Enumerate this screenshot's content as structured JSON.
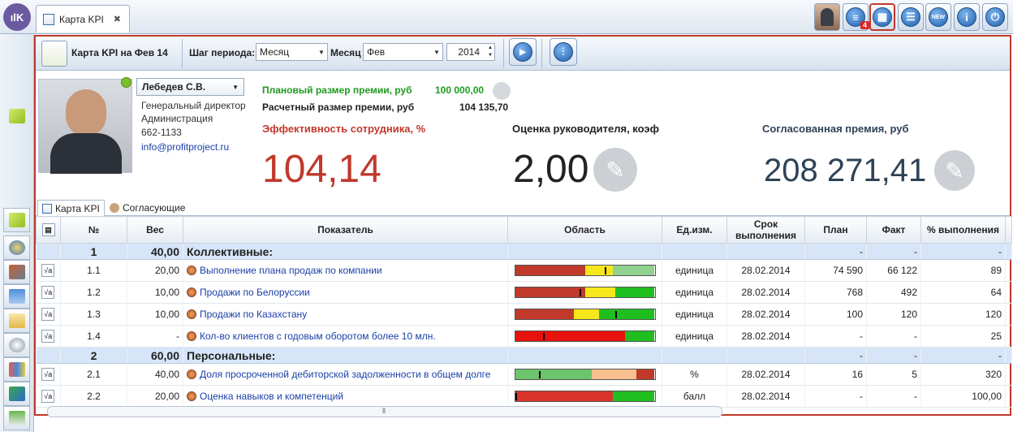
{
  "app": {
    "logo": "ılK",
    "tab_label": "Карта KPI",
    "tab_close": "✖",
    "badge": "4",
    "colors": {
      "accent": "#c0392b",
      "link": "#1a3fa8",
      "group_bg": "#d6e5f7"
    }
  },
  "top_icons": [
    "avatar-icon",
    "messages-icon",
    "grid-icon",
    "list-icon",
    "new-icon",
    "info-icon",
    "power-icon"
  ],
  "toolbar": {
    "title": "Карта KPI на Фев 14",
    "period_label": "Шаг периода:",
    "period_value": "Месяц",
    "month_label": "Месяц",
    "month_value": "Фев",
    "year_value": "2014"
  },
  "employee": {
    "name": "Лебедев С.В.",
    "position": "Генеральный директор",
    "department": "Администрация",
    "phone": "662-1133",
    "email": "info@profitproject.ru"
  },
  "bonus": {
    "planned_label": "Плановый размер премии, руб",
    "planned_value": "100 000,00",
    "calc_label": "Расчетный размер премии, руб",
    "calc_value": "104 135,70"
  },
  "kpis": {
    "eff_label": "Эффективность сотрудника, %",
    "eff_value": "104,14",
    "mgr_label": "Оценка руководителя, коэф",
    "mgr_value": "2,00",
    "agreed_label": "Согласованная премия, руб",
    "agreed_value": "208 271,41"
  },
  "subtabs": [
    "Карта KPI",
    "Согласующие"
  ],
  "columns": [
    "№",
    "Вес",
    "Показатель",
    "Область",
    "Ед.изм.",
    "Срок выполнения",
    "План",
    "Факт",
    "% выполнения"
  ],
  "group1": {
    "num": "1",
    "weight": "40,00",
    "name": "Коллективные:",
    "dash": "-"
  },
  "group2": {
    "num": "2",
    "weight": "60,00",
    "name": "Персональные:",
    "dash": "-"
  },
  "rows": [
    {
      "num": "1.1",
      "weight": "20,00",
      "name": "Выполнение плана продаж по компании",
      "unit": "единица",
      "date": "28.02.2014",
      "plan": "74 590",
      "fact": "66 122",
      "pct": "89",
      "bar": [
        [
          "#c0392b",
          0.5
        ],
        [
          "#f5e71b",
          0.2
        ],
        [
          "#8fd18f",
          0.3
        ]
      ],
      "marker": 0.64
    },
    {
      "num": "1.2",
      "weight": "10,00",
      "name": "Продажи по Белоруссии",
      "unit": "единица",
      "date": "28.02.2014",
      "plan": "768",
      "fact": "492",
      "pct": "64",
      "bar": [
        [
          "#c0392b",
          0.5
        ],
        [
          "#f5e71b",
          0.22
        ],
        [
          "#1fbf1f",
          0.28
        ]
      ],
      "marker": 0.46
    },
    {
      "num": "1.3",
      "weight": "10,00",
      "name": "Продажи по Казахстану",
      "unit": "единица",
      "date": "28.02.2014",
      "plan": "100",
      "fact": "120",
      "pct": "120",
      "bar": [
        [
          "#c0392b",
          0.42
        ],
        [
          "#f5e71b",
          0.18
        ],
        [
          "#1fbf1f",
          0.4
        ]
      ],
      "marker": 0.72
    },
    {
      "num": "1.4",
      "weight": "-",
      "name": "Кол-во клиентов с годовым оборотом более 10 млн.",
      "unit": "единица",
      "date": "28.02.2014",
      "plan": "-",
      "fact": "-",
      "pct": "25",
      "bar": [
        [
          "#e8120c",
          0.79
        ],
        [
          "#1fbf1f",
          0.21
        ]
      ],
      "marker": 0.2
    },
    {
      "num": "2.1",
      "weight": "40,00",
      "name": "Доля просроченной дебиторской задолженности в общем долге",
      "unit": "%",
      "date": "28.02.2014",
      "plan": "16",
      "fact": "5",
      "pct": "320",
      "bar": [
        [
          "#6cc46c",
          0.55
        ],
        [
          "#f7bf8e",
          0.32
        ],
        [
          "#c0392b",
          0.13
        ]
      ],
      "marker": 0.17
    },
    {
      "num": "2.2",
      "weight": "20,00",
      "name": "Оценка навыков и компетенций",
      "unit": "балл",
      "date": "28.02.2014",
      "plan": "-",
      "fact": "-",
      "pct": "100,00",
      "bar": [
        [
          "#d8342c",
          0.7
        ],
        [
          "#1fbf1f",
          0.3
        ]
      ],
      "marker": 0.0
    }
  ]
}
